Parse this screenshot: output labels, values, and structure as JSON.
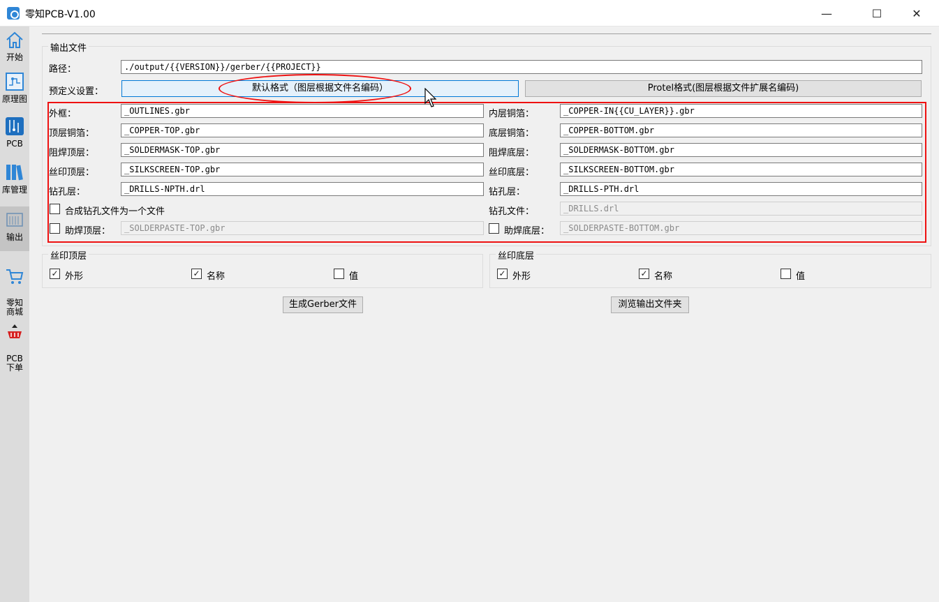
{
  "window": {
    "title": "零知PCB-V1.00",
    "minimize": "—",
    "maximize": "☐",
    "close": "✕"
  },
  "sidebar": {
    "items": [
      {
        "label": "开始",
        "icon": "home-icon"
      },
      {
        "label": "原理图",
        "icon": "schematic-icon"
      },
      {
        "label": "PCB",
        "icon": "pcb-icon"
      },
      {
        "label": "库管理",
        "icon": "library-icon"
      },
      {
        "label": "输出",
        "icon": "output-icon"
      },
      {
        "label": "零知\n商城",
        "icon": "cart-icon"
      },
      {
        "label": "PCB\n下单",
        "icon": "pcb-order-icon"
      }
    ]
  },
  "output": {
    "group_title": "输出文件",
    "path_label": "路径：",
    "path_value": "./output/{{VERSION}}/gerber/{{PROJECT}}",
    "preset_label": "预定义设置：",
    "preset_default": "默认格式（图层根据文件名编码）",
    "preset_protel": "Protel格式(图层根据文件扩展名编码)",
    "rows_left": [
      {
        "label": "外框：",
        "value": "_OUTLINES.gbr"
      },
      {
        "label": "顶层铜箔：",
        "value": "_COPPER-TOP.gbr"
      },
      {
        "label": "阻焊顶层：",
        "value": "_SOLDERMASK-TOP.gbr"
      },
      {
        "label": "丝印顶层：",
        "value": "_SILKSCREEN-TOP.gbr"
      },
      {
        "label": "钻孔层：",
        "value": "_DRILLS-NPTH.drl"
      }
    ],
    "rows_right": [
      {
        "label": "内层铜箔：",
        "value": "_COPPER-IN{{CU_LAYER}}.gbr"
      },
      {
        "label": "底层铜箔：",
        "value": "_COPPER-BOTTOM.gbr"
      },
      {
        "label": "阻焊底层：",
        "value": "_SOLDERMASK-BOTTOM.gbr"
      },
      {
        "label": "丝印底层：",
        "value": "_SILKSCREEN-BOTTOM.gbr"
      },
      {
        "label": "钻孔层：",
        "value": "_DRILLS-PTH.drl"
      }
    ],
    "merge_drill_label": "合成钻孔文件为一个文件",
    "merge_drill_checked": false,
    "drill_file_label": "钻孔文件：",
    "drill_file_value": "_DRILLS.drl",
    "paste_top_label": "助焊顶层：",
    "paste_top_value": "_SOLDERPASTE-TOP.gbr",
    "paste_top_checked": false,
    "paste_bottom_label": "助焊底层：",
    "paste_bottom_value": "_SOLDERPASTE-BOTTOM.gbr",
    "paste_bottom_checked": false
  },
  "silk_top": {
    "title": "丝印顶层",
    "options": [
      {
        "label": "外形",
        "checked": true
      },
      {
        "label": "名称",
        "checked": true
      },
      {
        "label": "值",
        "checked": false
      }
    ]
  },
  "silk_bottom": {
    "title": "丝印底层",
    "options": [
      {
        "label": "外形",
        "checked": true
      },
      {
        "label": "名称",
        "checked": true
      },
      {
        "label": "值",
        "checked": false
      }
    ]
  },
  "actions": {
    "generate": "生成Gerber文件",
    "browse": "浏览输出文件夹"
  },
  "check_mark": "✓"
}
